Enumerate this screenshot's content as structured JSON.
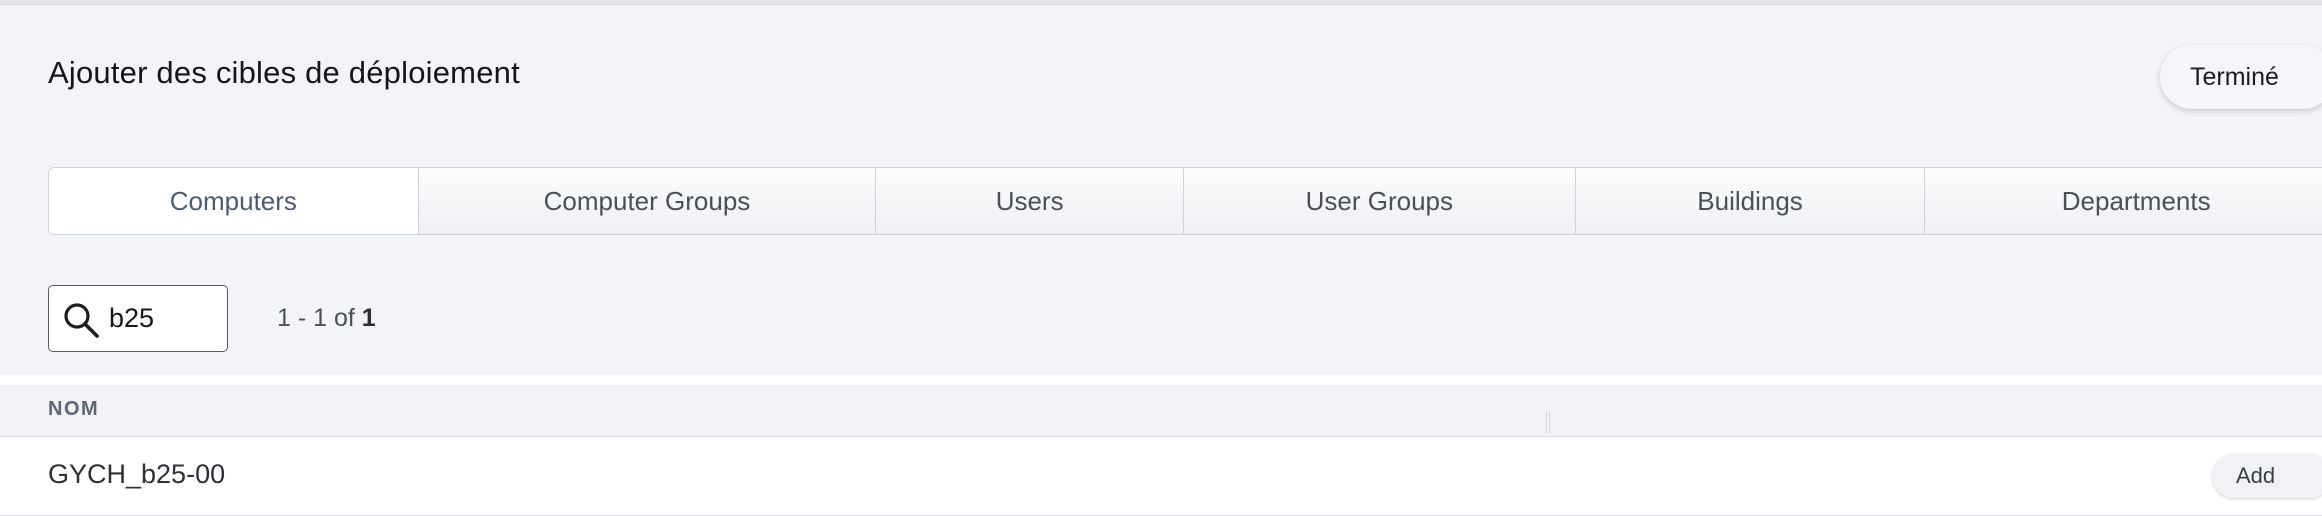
{
  "dialog": {
    "title": "Ajouter des cibles de déploiement",
    "done_label": "Terminé"
  },
  "tabs": [
    {
      "label": "Computers",
      "active": true
    },
    {
      "label": "Computer Groups",
      "active": false
    },
    {
      "label": "Users",
      "active": false
    },
    {
      "label": "User Groups",
      "active": false
    },
    {
      "label": "Buildings",
      "active": false
    },
    {
      "label": "Departments",
      "active": false
    }
  ],
  "search": {
    "value": "b25",
    "icon": "search-icon"
  },
  "pagination": {
    "range": "1 - 1 of ",
    "total": "1"
  },
  "table": {
    "columns": [
      "NOM"
    ],
    "rows": [
      {
        "name": "GYCH_b25-00",
        "action": "Add"
      }
    ]
  },
  "colors": {
    "background": "#f3f4f8",
    "active_tab_text": "#4d5b70",
    "header_text": "#5c6778"
  }
}
